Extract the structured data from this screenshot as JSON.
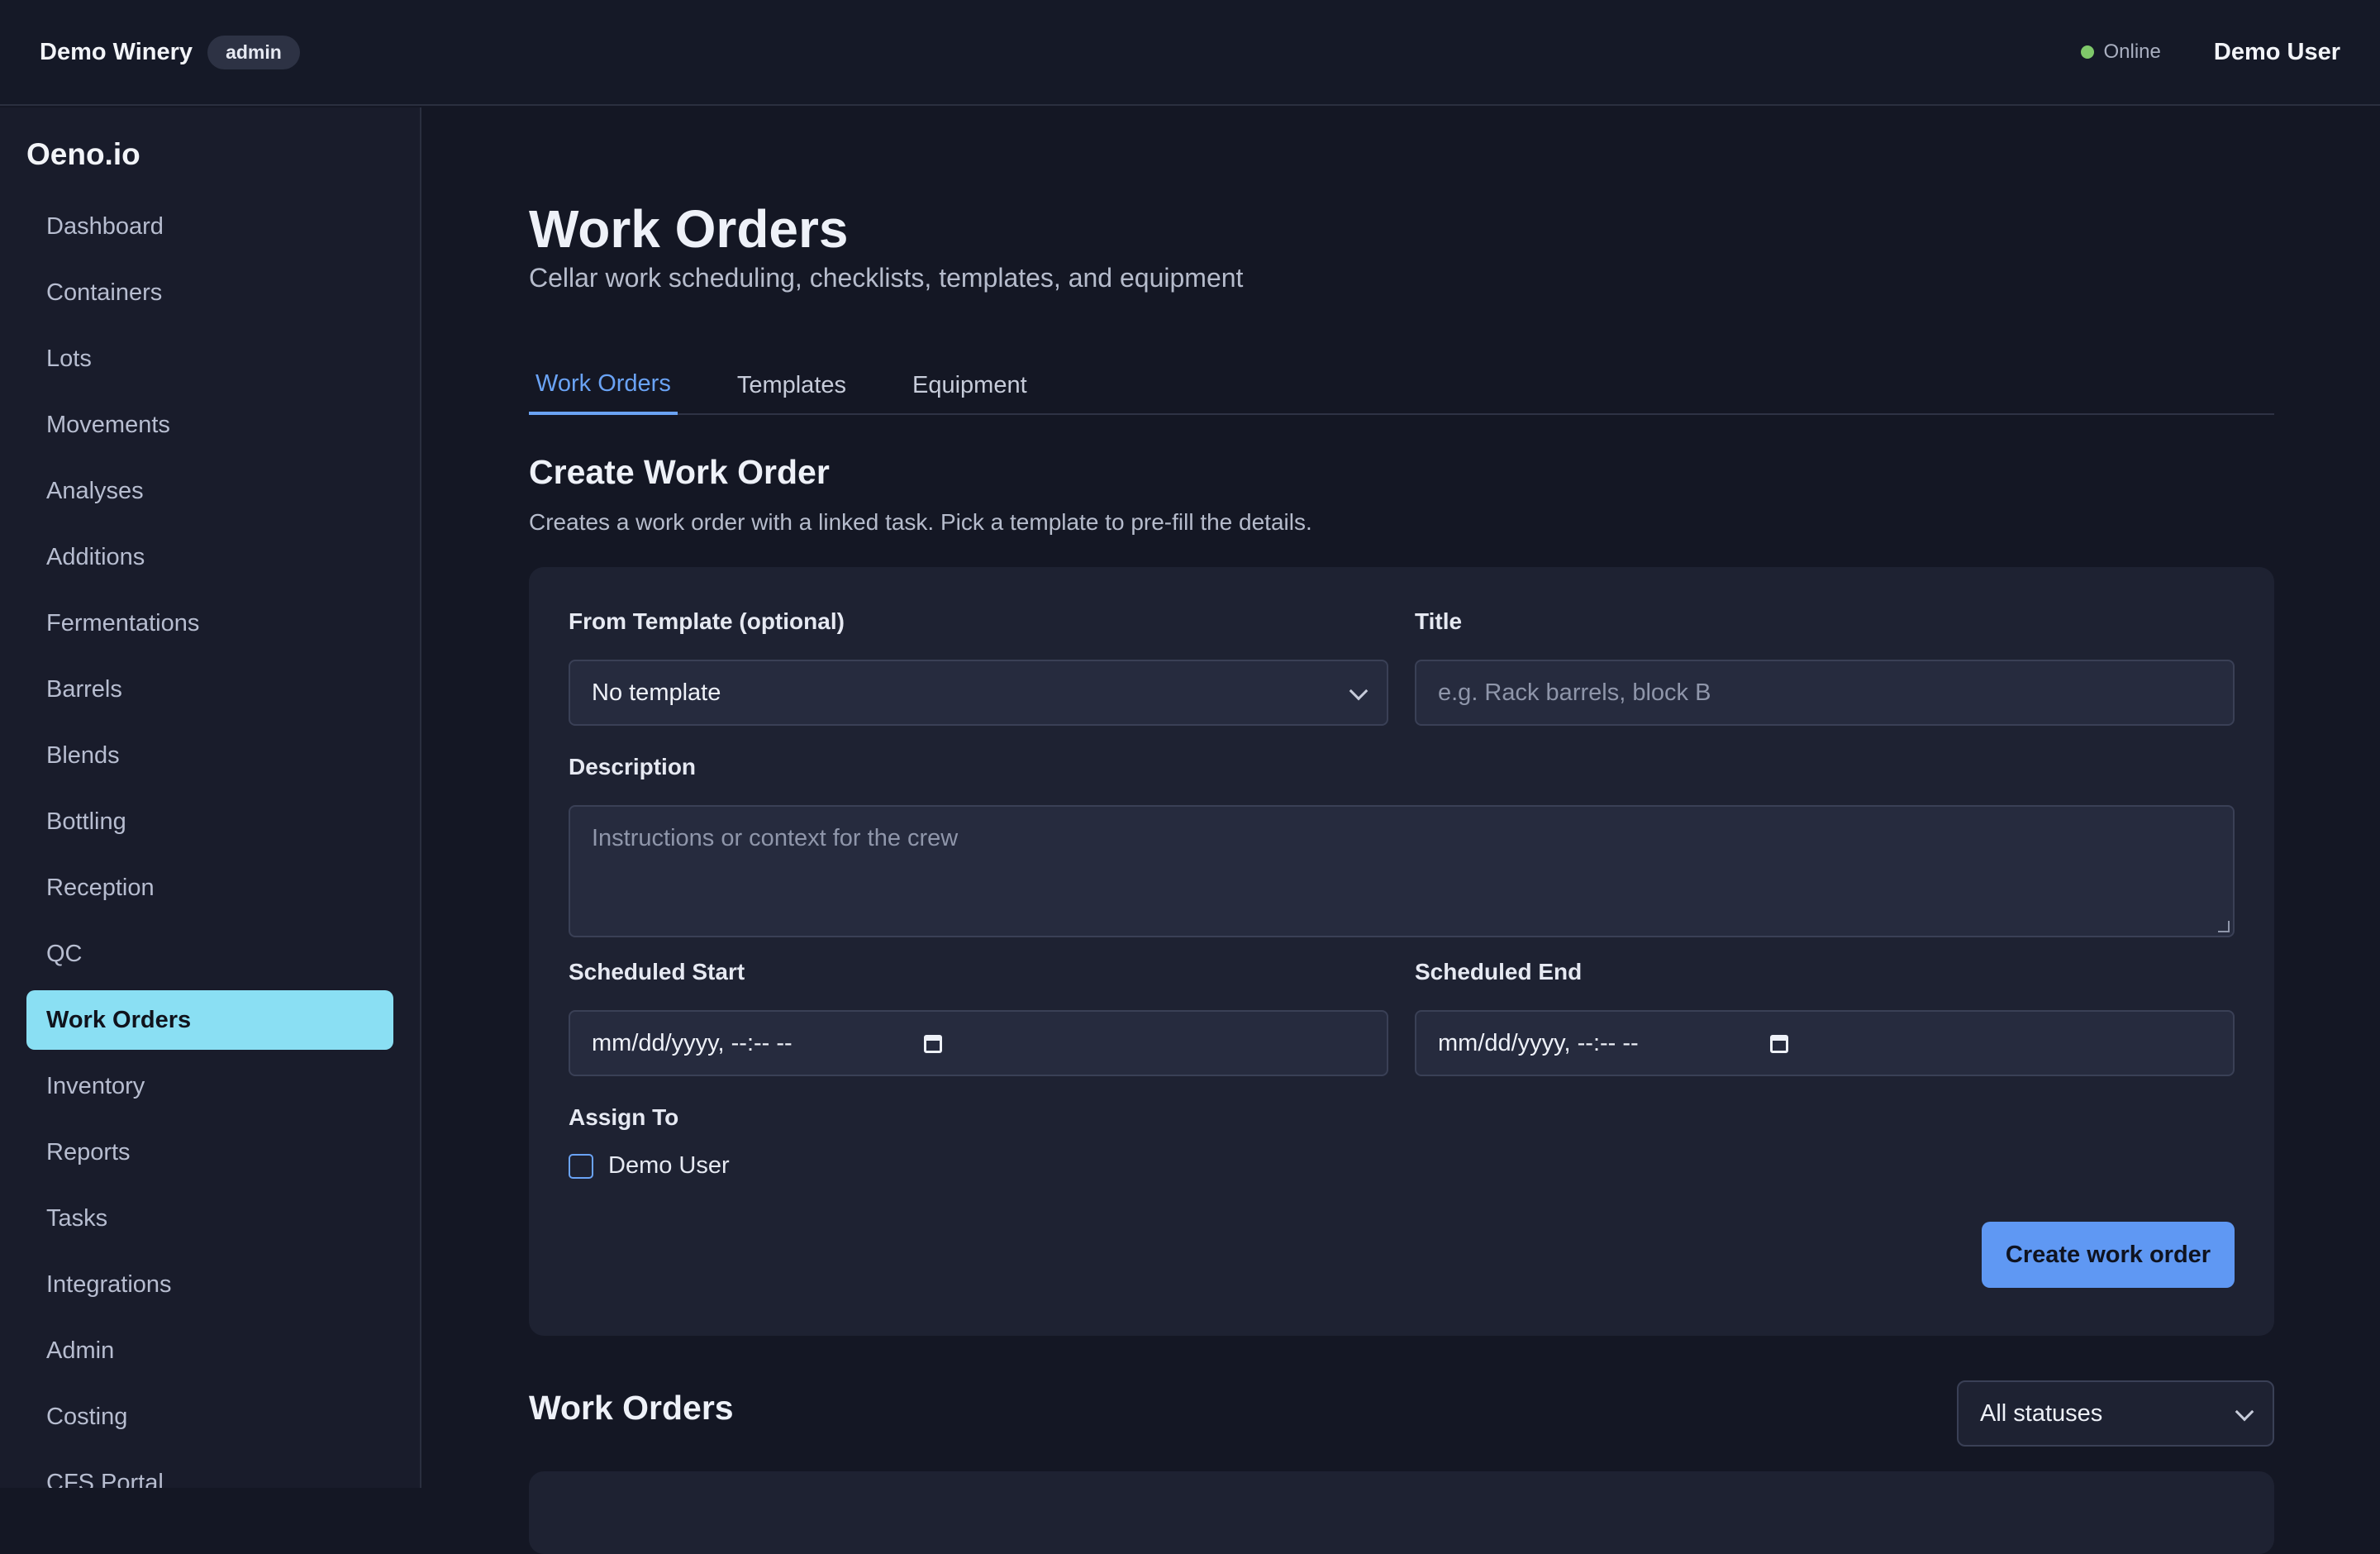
{
  "topbar": {
    "org_name": "Demo Winery",
    "role_badge": "admin",
    "status": "Online",
    "user_name": "Demo User"
  },
  "sidebar": {
    "brand": "Oeno.io",
    "items": [
      {
        "label": "Dashboard"
      },
      {
        "label": "Containers"
      },
      {
        "label": "Lots"
      },
      {
        "label": "Movements"
      },
      {
        "label": "Analyses"
      },
      {
        "label": "Additions"
      },
      {
        "label": "Fermentations"
      },
      {
        "label": "Barrels"
      },
      {
        "label": "Blends"
      },
      {
        "label": "Bottling"
      },
      {
        "label": "Reception"
      },
      {
        "label": "QC"
      },
      {
        "label": "Work Orders"
      },
      {
        "label": "Inventory"
      },
      {
        "label": "Reports"
      },
      {
        "label": "Tasks"
      },
      {
        "label": "Integrations"
      },
      {
        "label": "Admin"
      },
      {
        "label": "Costing"
      },
      {
        "label": "CFS Portal"
      }
    ],
    "active_item": "Work Orders"
  },
  "page": {
    "title": "Work Orders",
    "subtitle": "Cellar work scheduling, checklists, templates, and equipment"
  },
  "tabs": [
    {
      "label": "Work Orders",
      "active": true
    },
    {
      "label": "Templates",
      "active": false
    },
    {
      "label": "Equipment",
      "active": false
    }
  ],
  "create": {
    "title": "Create Work Order",
    "description": "Creates a work order with a linked task. Pick a template to pre-fill the details.",
    "template_label": "From Template (optional)",
    "template_value": "No template",
    "title_label": "Title",
    "title_placeholder": "e.g. Rack barrels, block B",
    "description_label": "Description",
    "description_placeholder": "Instructions or context for the crew",
    "start_label": "Scheduled Start",
    "start_value": "mm/dd/yyyy, --:-- --",
    "end_label": "Scheduled End",
    "end_value": "mm/dd/yyyy, --:-- --",
    "assign_label": "Assign To",
    "assignee": "Demo User",
    "submit_label": "Create work order"
  },
  "list": {
    "title": "Work Orders",
    "status_filter": "All statuses"
  },
  "colors": {
    "accent": "#5f98f3",
    "active_nav": "#8adff3",
    "online": "#7fc86a"
  }
}
